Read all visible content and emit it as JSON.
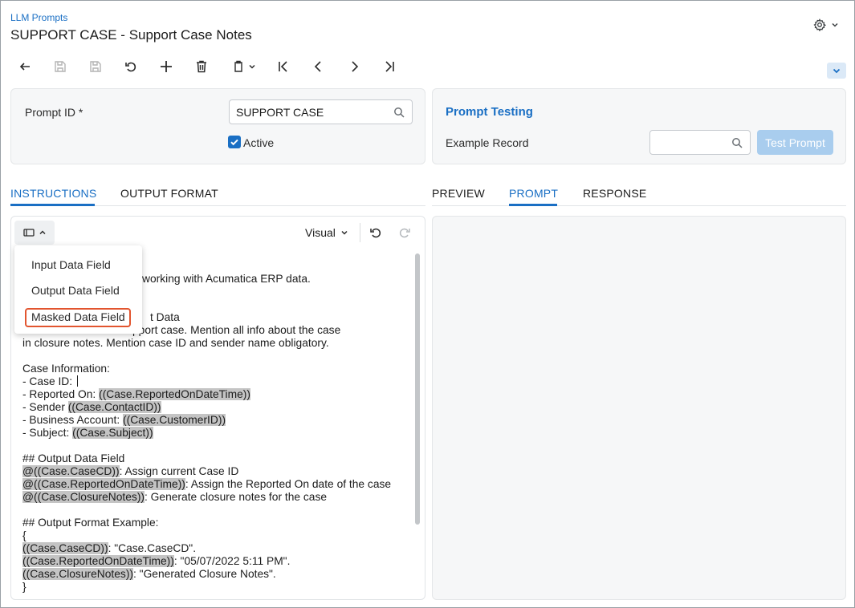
{
  "header": {
    "breadcrumb": "LLM Prompts",
    "title": "SUPPORT CASE - Support Case Notes"
  },
  "toolbar": {
    "icons": [
      "undo-arrow-icon",
      "save-and-close-icon",
      "save-icon",
      "cancel-icon",
      "add-icon",
      "delete-icon",
      "copy-paste-icon",
      "first-record-icon",
      "previous-record-icon",
      "next-record-icon",
      "last-record-icon"
    ]
  },
  "form": {
    "prompt_id_label": "Prompt ID *",
    "prompt_id_value": "SUPPORT CASE",
    "active_label": "Active",
    "active_checked": true
  },
  "testing": {
    "title": "Prompt Testing",
    "example_record_label": "Example Record",
    "example_record_value": "",
    "test_button": "Test Prompt"
  },
  "left_tabs": [
    {
      "label": "INSTRUCTIONS",
      "active": true
    },
    {
      "label": "OUTPUT FORMAT",
      "active": false
    }
  ],
  "right_tabs": [
    {
      "label": "PREVIEW",
      "active": false
    },
    {
      "label": "PROMPT",
      "active": true
    },
    {
      "label": "RESPONSE",
      "active": false
    }
  ],
  "editor": {
    "mode": "Visual",
    "dropdown": [
      "Input Data Field",
      "Output Data Field",
      "Masked Data Field"
    ],
    "lines": [
      [
        {
          "t": "working with Acumatica ERP data."
        }
      ],
      [
        {
          "t": ""
        }
      ],
      [
        {
          "t": ""
        }
      ],
      [
        {
          "t": "t Data"
        }
      ],
      [
        {
          "t": "for a support case. Mention all info about the case"
        }
      ],
      [
        {
          "t": "in closure notes. Mention case ID and sender name obligatory."
        }
      ],
      [
        {
          "t": ""
        }
      ],
      [
        {
          "t": "Case Information:"
        }
      ],
      [
        {
          "t": "- Case ID: "
        }
      ],
      [
        {
          "t": "- Reported On: "
        },
        {
          "t": "((Case.ReportedOnDateTime))",
          "h": true
        }
      ],
      [
        {
          "t": "- Sender "
        },
        {
          "t": "((Case.ContactID))",
          "h": true
        }
      ],
      [
        {
          "t": "- Business Account: "
        },
        {
          "t": "((Case.CustomerID))",
          "h": true
        }
      ],
      [
        {
          "t": "- Subject: "
        },
        {
          "t": "((Case.Subject))",
          "h": true
        }
      ],
      [
        {
          "t": ""
        }
      ],
      [
        {
          "t": "## Output Data Field"
        }
      ],
      [
        {
          "t": "@((Case.CaseCD))",
          "h": true
        },
        {
          "t": ": Assign current Case ID"
        }
      ],
      [
        {
          "t": "@((Case.ReportedOnDateTime))",
          "h": true
        },
        {
          "t": ": Assign the Reported On date of the case"
        }
      ],
      [
        {
          "t": "@((Case.ClosureNotes))",
          "h": true
        },
        {
          "t": ": Generate closure notes for the case"
        }
      ],
      [
        {
          "t": ""
        }
      ],
      [
        {
          "t": "## Output Format Example:"
        }
      ],
      [
        {
          "t": "{"
        }
      ],
      [
        {
          "t": "((Case.CaseCD))",
          "h": true
        },
        {
          "t": ": \"Case.CaseCD\"."
        }
      ],
      [
        {
          "t": "((Case.ReportedOnDateTime))",
          "h": true
        },
        {
          "t": ": \"05/07/2022 5:11 PM\"."
        }
      ],
      [
        {
          "t": "((Case.ClosureNotes))",
          "h": true
        },
        {
          "t": ": \"Generated Closure Notes\"."
        }
      ],
      [
        {
          "t": "}"
        }
      ]
    ]
  }
}
